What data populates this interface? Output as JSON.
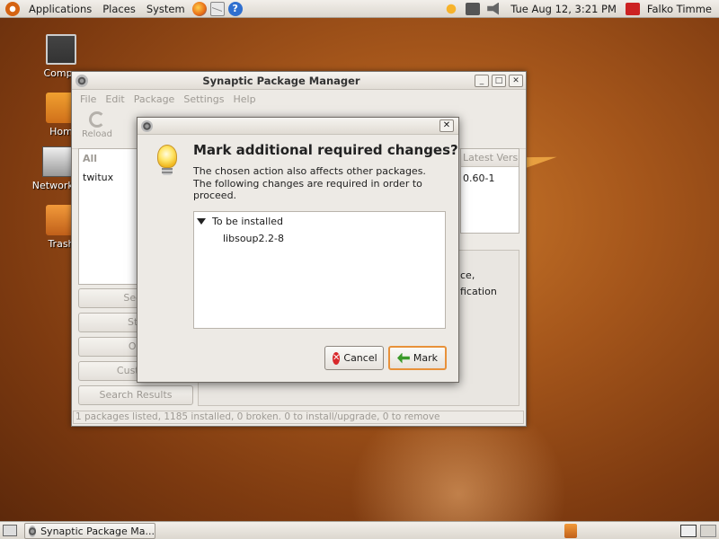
{
  "top_panel": {
    "menus": [
      "Applications",
      "Places",
      "System"
    ],
    "clock": "Tue Aug 12,  3:21 PM",
    "user": "Falko Timme"
  },
  "desktop_icons": [
    "Compu",
    "Hom",
    "Network S",
    "Trash"
  ],
  "synaptic": {
    "title": "Synaptic Package Manager",
    "menu": [
      "File",
      "Edit",
      "Package",
      "Settings",
      "Help"
    ],
    "toolbar_reload": "Reload",
    "filters": {
      "all": "All",
      "item": "twitux"
    },
    "side_buttons": [
      "Secti",
      "Sta",
      "Ori",
      "Custom",
      "Search Results"
    ],
    "table_header": "Latest Versio",
    "table_value": "0.60-1",
    "desc_lines": [
      "ce,",
      "fication"
    ],
    "status": "1 packages listed, 1185 installed, 0 broken. 0 to install/upgrade, 0 to remove"
  },
  "dialog": {
    "title_close": "✕",
    "heading": "Mark additional required changes?",
    "body": "The chosen action also affects other packages. The following changes are required in order to proceed.",
    "group": "To be installed",
    "package": "libsoup2.2-8",
    "cancel": "Cancel",
    "mark": "Mark"
  },
  "taskbar": {
    "task": "Synaptic Package Ma..."
  }
}
